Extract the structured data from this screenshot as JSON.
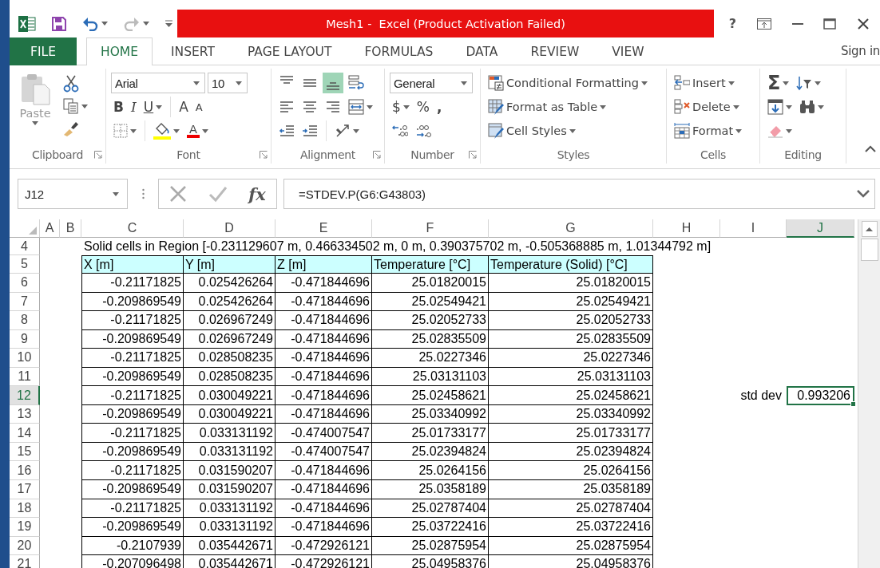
{
  "window": {
    "title": "Mesh1 -  Excel (Product Activation Failed)",
    "help": "?",
    "account": "Sign in"
  },
  "ribbon_tabs": [
    {
      "label": "FILE",
      "kind": "file",
      "selected": false
    },
    {
      "label": "HOME",
      "kind": "tab",
      "selected": true
    },
    {
      "label": "INSERT",
      "kind": "tab",
      "selected": false
    },
    {
      "label": "PAGE LAYOUT",
      "kind": "tab",
      "selected": false
    },
    {
      "label": "FORMULAS",
      "kind": "tab",
      "selected": false
    },
    {
      "label": "DATA",
      "kind": "tab",
      "selected": false
    },
    {
      "label": "REVIEW",
      "kind": "tab",
      "selected": false
    },
    {
      "label": "VIEW",
      "kind": "tab",
      "selected": false
    }
  ],
  "clipboard": {
    "label": "Clipboard",
    "paste": "Paste",
    "disabled": true
  },
  "font": {
    "label": "Font",
    "name": "Arial",
    "size": "10",
    "bold": "B",
    "italic": "I",
    "underline": "U",
    "grow": "A",
    "shrink": "A",
    "font_color": "A"
  },
  "alignment": {
    "label": "Alignment",
    "vertical": [
      {
        "kind": "top",
        "selected": false
      },
      {
        "kind": "middle",
        "selected": false
      },
      {
        "kind": "bottom",
        "selected": true
      }
    ]
  },
  "number": {
    "label": "Number",
    "format": "General",
    "currency": "$",
    "percent": "%",
    "comma": ","
  },
  "styles": {
    "label": "Styles",
    "commands": [
      "Conditional Formatting",
      "Format as Table",
      "Cell Styles"
    ]
  },
  "cells": {
    "label": "Cells",
    "commands": [
      "Insert",
      "Delete",
      "Format"
    ]
  },
  "editing": {
    "label": "Editing",
    "sum": "Σ"
  },
  "formula_bar": {
    "name_box": "J12",
    "function_button": "fx",
    "formula": "=STDEV.P(G6:G43803)"
  },
  "sheet": {
    "columns": [
      {
        "label": "A",
        "selected": false
      },
      {
        "label": "B",
        "selected": false
      },
      {
        "label": "C",
        "selected": false
      },
      {
        "label": "D",
        "selected": false
      },
      {
        "label": "E",
        "selected": false
      },
      {
        "label": "F",
        "selected": false
      },
      {
        "label": "G",
        "selected": false
      },
      {
        "label": "H",
        "selected": false
      },
      {
        "label": "I",
        "selected": false
      },
      {
        "label": "J",
        "selected": true
      }
    ],
    "rows": [
      {
        "number": "4",
        "selected": false,
        "title": "Solid cells in Region [-0.231129607 m, 0.466334502 m, 0 m, 0.390375702 m, -0.505368885 m, 1.01344792 m]"
      },
      {
        "number": "5",
        "selected": false,
        "headers": [
          "X [m]",
          "Y [m]",
          "Z [m]",
          "Temperature [°C]",
          "Temperature (Solid) [°C]"
        ]
      },
      {
        "number": "6",
        "selected": false,
        "values": [
          "-0.21171825",
          "0.025426264",
          "-0.471844696",
          "25.01820015",
          "25.01820015"
        ]
      },
      {
        "number": "7",
        "selected": false,
        "values": [
          "-0.209869549",
          "0.025426264",
          "-0.471844696",
          "25.02549421",
          "25.02549421"
        ]
      },
      {
        "number": "8",
        "selected": false,
        "values": [
          "-0.21171825",
          "0.026967249",
          "-0.471844696",
          "25.02052733",
          "25.02052733"
        ]
      },
      {
        "number": "9",
        "selected": false,
        "values": [
          "-0.209869549",
          "0.026967249",
          "-0.471844696",
          "25.02835509",
          "25.02835509"
        ]
      },
      {
        "number": "10",
        "selected": false,
        "values": [
          "-0.21171825",
          "0.028508235",
          "-0.471844696",
          "25.0227346",
          "25.0227346"
        ]
      },
      {
        "number": "11",
        "selected": false,
        "values": [
          "-0.209869549",
          "0.028508235",
          "-0.471844696",
          "25.03131103",
          "25.03131103"
        ]
      },
      {
        "number": "12",
        "selected": true,
        "values": [
          "-0.21171825",
          "0.030049221",
          "-0.471844696",
          "25.02458621",
          "25.02458621"
        ],
        "label": "std dev",
        "result": {
          "text": "0.993206",
          "selected": true
        }
      },
      {
        "number": "13",
        "selected": false,
        "values": [
          "-0.209869549",
          "0.030049221",
          "-0.471844696",
          "25.03340992",
          "25.03340992"
        ]
      },
      {
        "number": "14",
        "selected": false,
        "values": [
          "-0.21171825",
          "0.033131192",
          "-0.474007547",
          "25.01733177",
          "25.01733177"
        ]
      },
      {
        "number": "15",
        "selected": false,
        "values": [
          "-0.209869549",
          "0.033131192",
          "-0.474007547",
          "25.02394824",
          "25.02394824"
        ]
      },
      {
        "number": "16",
        "selected": false,
        "values": [
          "-0.21171825",
          "0.031590207",
          "-0.471844696",
          "25.0264156",
          "25.0264156"
        ]
      },
      {
        "number": "17",
        "selected": false,
        "values": [
          "-0.209869549",
          "0.031590207",
          "-0.471844696",
          "25.0358189",
          "25.0358189"
        ]
      },
      {
        "number": "18",
        "selected": false,
        "values": [
          "-0.21171825",
          "0.033131192",
          "-0.471844696",
          "25.02787404",
          "25.02787404"
        ]
      },
      {
        "number": "19",
        "selected": false,
        "values": [
          "-0.209869549",
          "0.033131192",
          "-0.471844696",
          "25.03722416",
          "25.03722416"
        ]
      },
      {
        "number": "20",
        "selected": false,
        "values": [
          "-0.2107939",
          "0.035442671",
          "-0.472926121",
          "25.02875954",
          "25.02875954"
        ]
      },
      {
        "number": "21",
        "selected": false,
        "values": [
          "-0.207096498",
          "0.035442671",
          "-0.472926121",
          "25.04958376",
          "25.04958376"
        ]
      }
    ]
  }
}
